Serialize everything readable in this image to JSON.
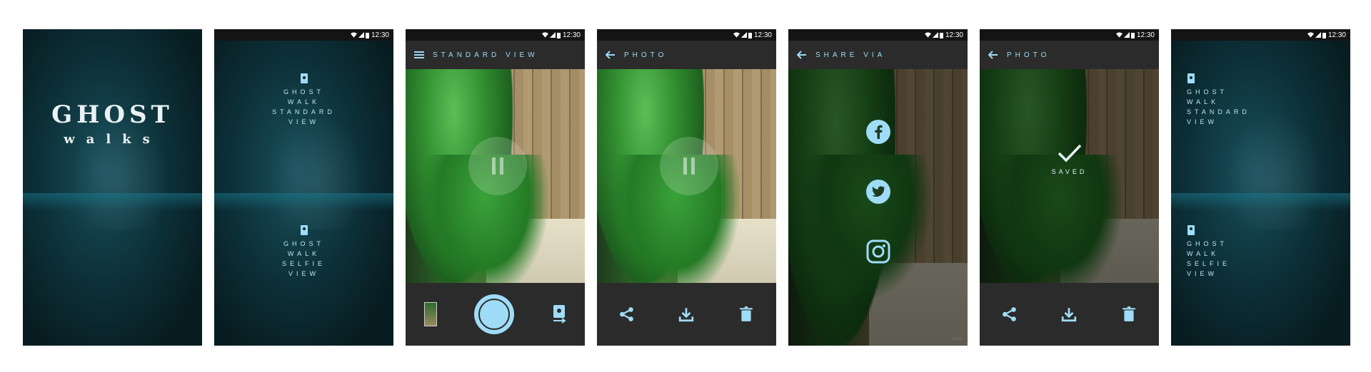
{
  "status": {
    "time": "12:30"
  },
  "splash": {
    "title": "GHOST",
    "subtitle": "walks"
  },
  "menu": {
    "option1_lines": [
      "GHOST",
      "WALK",
      "STANDARD",
      "VIEW"
    ],
    "option2_lines": [
      "GHOST",
      "WALK",
      "SELFIE",
      "VIEW"
    ]
  },
  "camera_screen": {
    "title": "STANDARD VIEW"
  },
  "photo_screen": {
    "title": "PHOTO"
  },
  "share_screen": {
    "title": "SHARE VIA",
    "targets": [
      "facebook-icon",
      "twitter-icon",
      "instagram-icon"
    ]
  },
  "saved_screen": {
    "title": "PHOTO",
    "saved_label": "SAVED"
  },
  "colors": {
    "accent": "#9fdcf7",
    "bar": "#2b2b2b",
    "statusbar": "#141414"
  }
}
